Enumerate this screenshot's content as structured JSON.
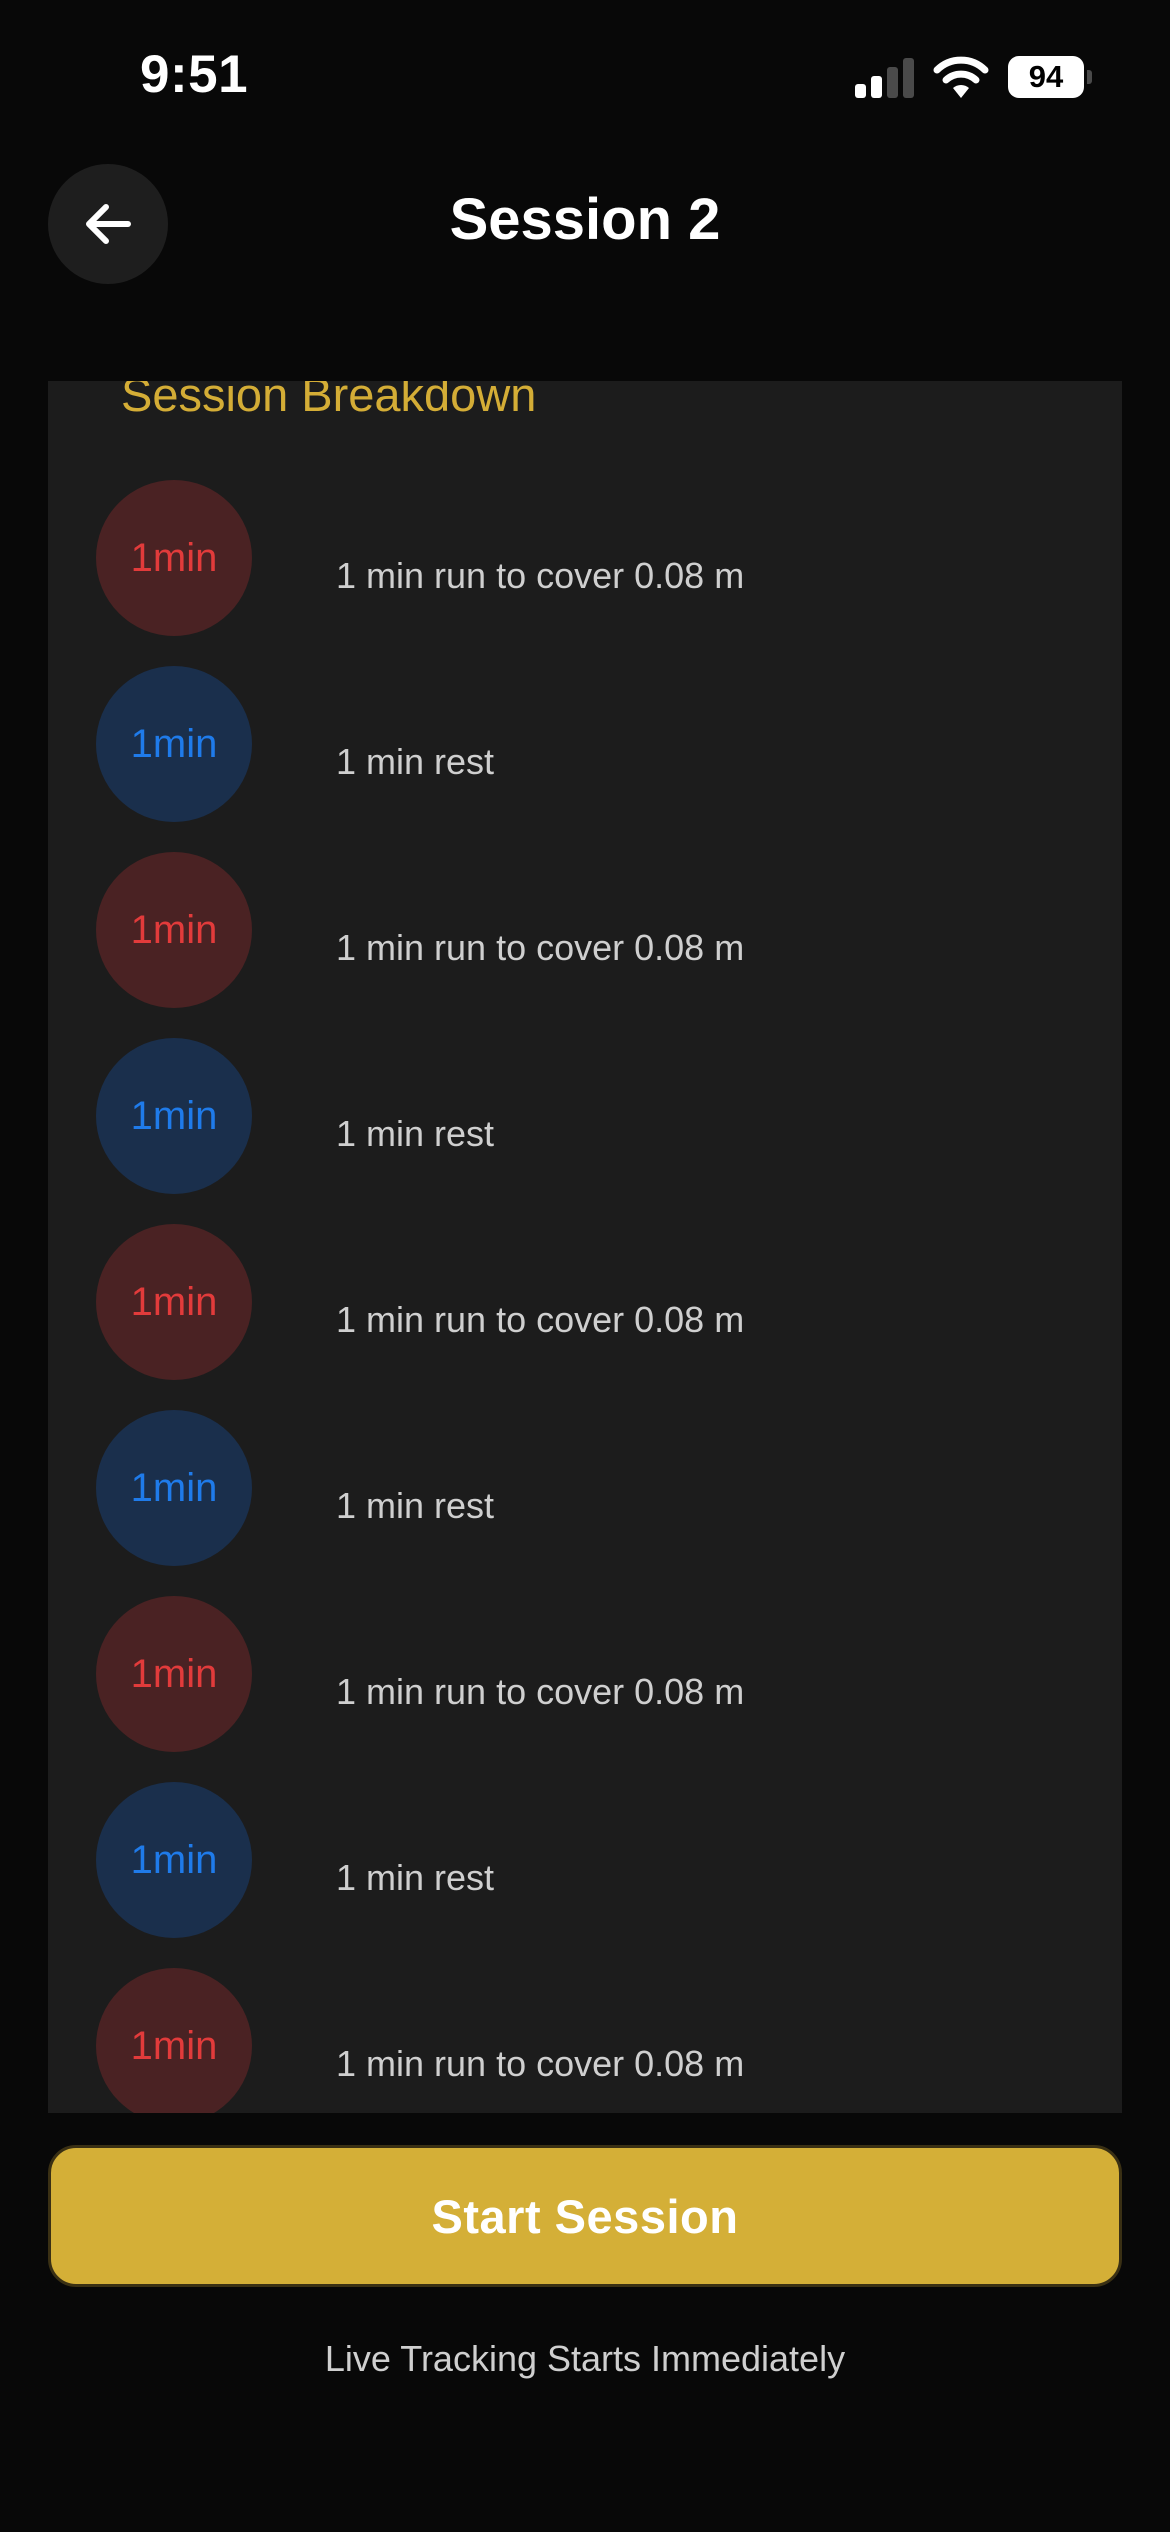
{
  "status_bar": {
    "time": "9:51",
    "battery": "94",
    "signal_icon": "cellular-signal-icon",
    "wifi_icon": "wifi-icon"
  },
  "header": {
    "title": "Session 2",
    "back_icon": "arrow-left-icon"
  },
  "breakdown": {
    "heading": "Session Breakdown",
    "steps": [
      {
        "type": "run",
        "badge": "1min",
        "text": "1 min run to cover 0.08 m"
      },
      {
        "type": "rest",
        "badge": "1min",
        "text": "1 min rest"
      },
      {
        "type": "run",
        "badge": "1min",
        "text": "1 min run to cover 0.08 m"
      },
      {
        "type": "rest",
        "badge": "1min",
        "text": "1 min rest"
      },
      {
        "type": "run",
        "badge": "1min",
        "text": "1 min run to cover 0.08 m"
      },
      {
        "type": "rest",
        "badge": "1min",
        "text": "1 min rest"
      },
      {
        "type": "run",
        "badge": "1min",
        "text": "1 min run to cover 0.08 m"
      },
      {
        "type": "rest",
        "badge": "1min",
        "text": "1 min rest"
      },
      {
        "type": "run",
        "badge": "1min",
        "text": "1 min run to cover 0.08 m"
      }
    ]
  },
  "start_button": {
    "label": "Start Session"
  },
  "footnote": "Live Tracking Starts Immediately",
  "colors": {
    "accent": "#d4af37",
    "run": "#e23b3b",
    "run_bg": "#4a2223",
    "rest": "#1f7bea",
    "rest_bg": "#1a2f4c"
  }
}
